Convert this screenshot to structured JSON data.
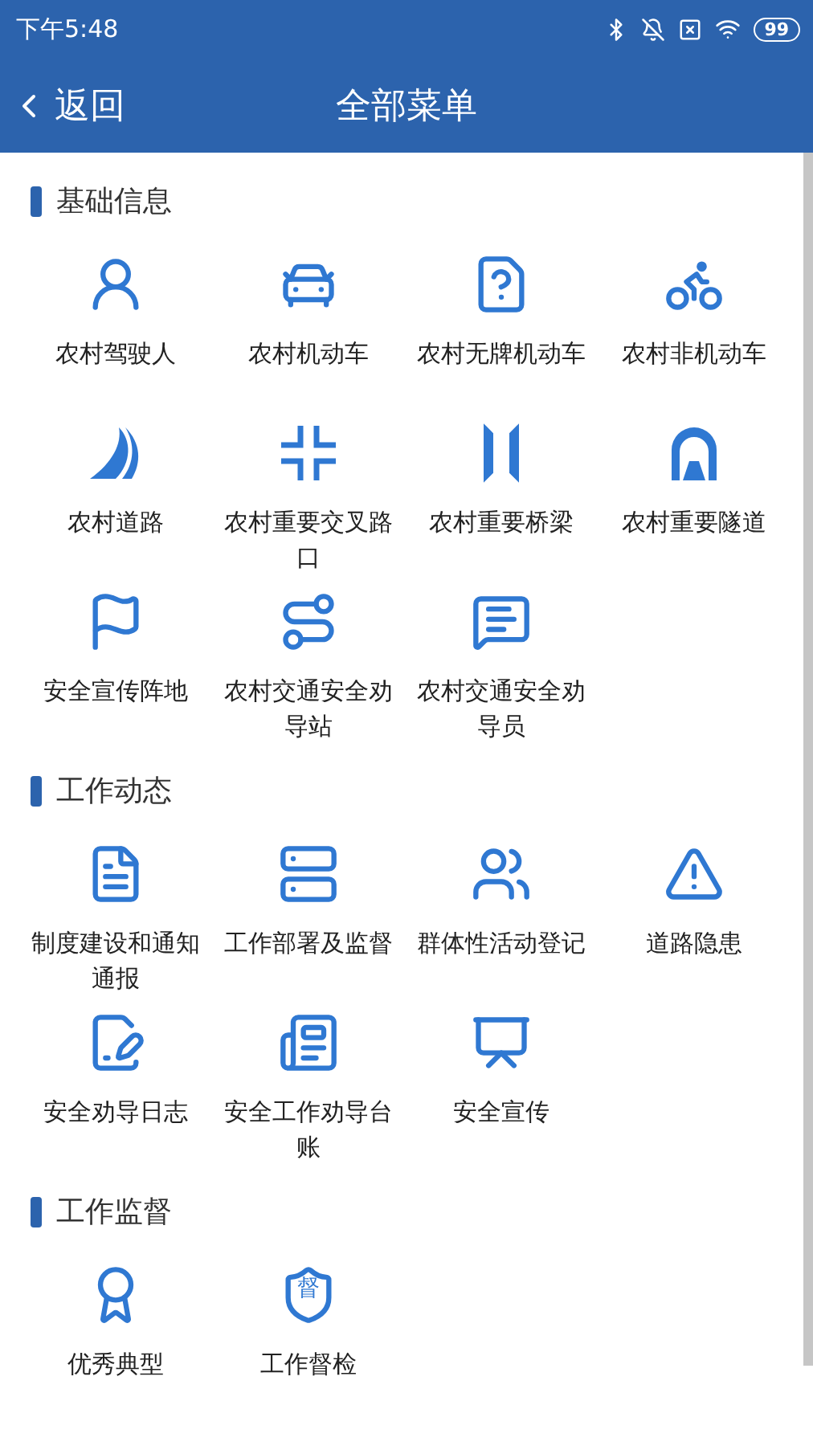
{
  "status_bar": {
    "time": "下午5:48",
    "battery": "99"
  },
  "header": {
    "back": "返回",
    "title": "全部菜单"
  },
  "sections": [
    {
      "title": "基础信息",
      "items": [
        {
          "label": "农村驾驶人"
        },
        {
          "label": "农村机动车"
        },
        {
          "label": "农村无牌机动车"
        },
        {
          "label": "农村非机动车"
        },
        {
          "label": "农村道路"
        },
        {
          "label": "农村重要交叉路口"
        },
        {
          "label": "农村重要桥梁"
        },
        {
          "label": "农村重要隧道"
        },
        {
          "label": "安全宣传阵地"
        },
        {
          "label": "农村交通安全劝导站"
        },
        {
          "label": "农村交通安全劝导员"
        }
      ]
    },
    {
      "title": "工作动态",
      "items": [
        {
          "label": "制度建设和通知通报"
        },
        {
          "label": "工作部署及监督"
        },
        {
          "label": "群体性活动登记"
        },
        {
          "label": "道路隐患"
        },
        {
          "label": "安全劝导日志"
        },
        {
          "label": "安全工作劝导台账"
        },
        {
          "label": "安全宣传"
        }
      ]
    },
    {
      "title": "工作监督",
      "items": [
        {
          "label": "优秀典型"
        },
        {
          "label": "工作督检",
          "badge_text": "督"
        }
      ]
    }
  ]
}
